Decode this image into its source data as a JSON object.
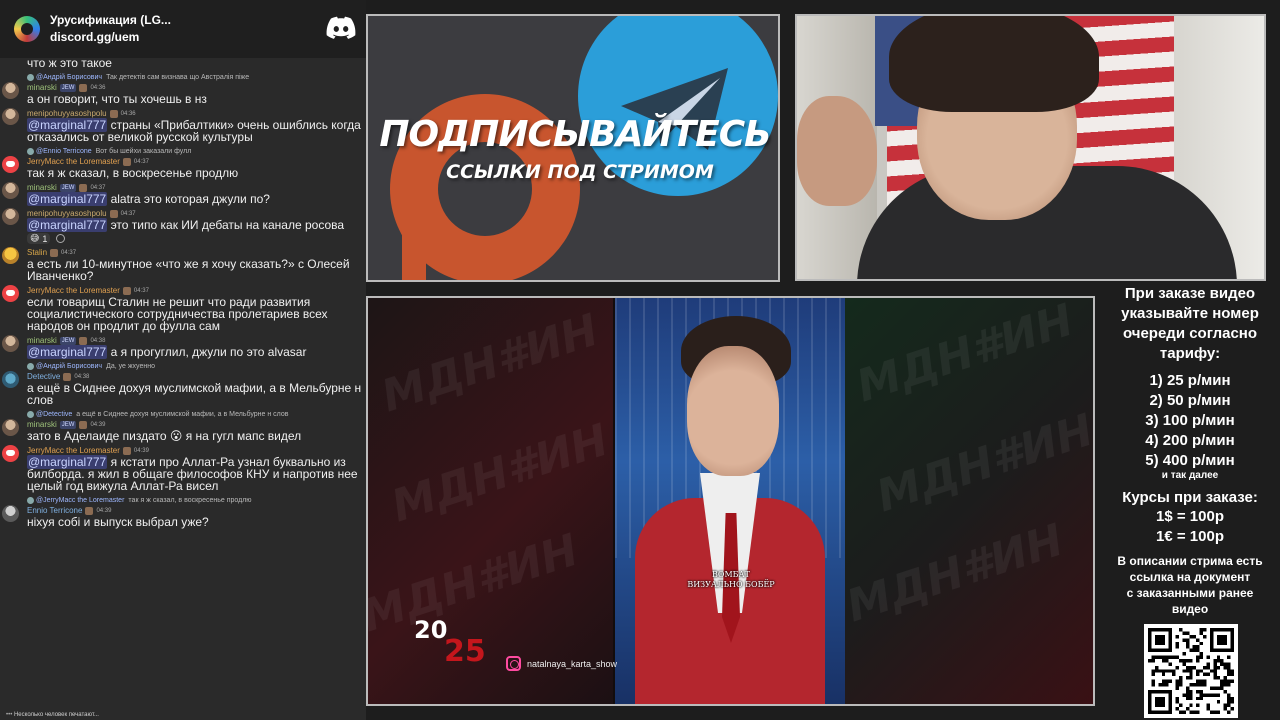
{
  "discord": {
    "server_name": "Урусификация (LG...",
    "server_link": "discord.gg/uem",
    "logo_icon": "discord-logo-icon"
  },
  "chat": {
    "messages": [
      {
        "body": "что ж это такое"
      },
      {
        "reply_author": "@Андрій Борисович",
        "reply_text": "Так детектів сам визнава що Австралія піже",
        "author": "minarski",
        "author_color": "#9ec27a",
        "badge": "JEW",
        "time": "04:36",
        "body": "а он говорит, что ты хочешь в нз",
        "avatar": "photo"
      },
      {
        "author": "menipohuyyasoshpolu",
        "author_color": "#c9a96e",
        "time": "04:36",
        "mention": "@marginal777",
        "body": " страны «Прибалтики» очень ошиблись когда отказались от великой русской культуры",
        "avatar": "photo"
      },
      {
        "reply_author": "@Ennio Terricone",
        "reply_text": "Вот бы шейхи заказали фулл",
        "author": "JerryMacc the Loremaster",
        "author_color": "#e0a050",
        "time": "04:37",
        "body": "так я ж сказал, в воскресенье продлю",
        "avatar": "discord"
      },
      {
        "author": "minarski",
        "author_color": "#9ec27a",
        "badge": "JEW",
        "time": "04:37",
        "mention": "@marginal777",
        "body": " alatra это которая джули по?",
        "avatar": "photo"
      },
      {
        "author": "menipohuyyasoshpolu",
        "author_color": "#c9a96e",
        "time": "04:37",
        "mention": "@marginal777",
        "body": " это типо как ИИ дебаты на канале росова",
        "avatar": "photo",
        "reaction_emoji": "😅",
        "reaction_count": "1"
      },
      {
        "author": "Stalin",
        "author_color": "#d7a64a",
        "time": "04:37",
        "body": "а есть ли 10-минутное  «что же я хочу сказать?» с Олесей Иванченко?",
        "avatar": "yellow"
      },
      {
        "author": "JerryMacc the Loremaster",
        "author_color": "#e0a050",
        "time": "04:37",
        "body": "если товарищ Сталин не решит что ради развития социалистического сотрудничества пролетариев всех народов  он продлит до фулла сам",
        "avatar": "discord"
      },
      {
        "author": "minarski",
        "author_color": "#9ec27a",
        "badge": "JEW",
        "time": "04:38",
        "mention": "@marginal777",
        "body": " а я прогуглил, джули по это alvasar",
        "avatar": "photo"
      },
      {
        "reply_author": "@Андрій Борисович",
        "reply_text": "Да, уе жхуенно",
        "author": "Detective",
        "author_color": "#7fb0e0",
        "time": "04:38",
        "body": "а ещё в Сиднее дохуя муслимской мафии, а в Мельбурне н слов",
        "avatar": "teal"
      },
      {
        "reply_author": "@Detective",
        "reply_text": "а ещё в Сиднее дохуя муслимской мафии, а в Мельбурне н слов",
        "author": "minarski",
        "author_color": "#9ec27a",
        "badge": "JEW",
        "time": "04:39",
        "body": "зато в Аделаиде пиздато 😮 я на гугл мапс видел",
        "avatar": "photo"
      },
      {
        "author": "JerryMacc the Loremaster",
        "author_color": "#e0a050",
        "time": "04:39",
        "mention": "@marginal777",
        "body": " я кстати про Аллат-Ра узнал буквально из билборда. я жил в общаге философов КНУ и напротив нее целый год вижула Аллат-Ра висел",
        "avatar": "discord"
      },
      {
        "reply_author": "@JerryMacc the Loremaster",
        "reply_text": "так я ж сказал, в воскресенье продлю",
        "author": "Ennio Terricone",
        "author_color": "#7fb0e0",
        "time": "04:39",
        "body": "ніхуя собі и выпуск выбрал уже?",
        "avatar": "gray"
      }
    ],
    "typing": "Несколько человек печатают..."
  },
  "promo": {
    "title": "ПОДПИСЫВАЙТЕСЬ",
    "subtitle": "ССЫЛКИ ПОД СТРИМОМ",
    "patreon_color": "#c8552e",
    "telegram_color": "#2b9ed9"
  },
  "video": {
    "caption_line1": "ВОМБАТ",
    "caption_line2": "ВИЗУАЛЬНО БОБЁР",
    "year_top": "20",
    "year_bottom": "25",
    "instagram_handle": "natalnaya_karta_show",
    "watermark": "МДН#ИН"
  },
  "order": {
    "title_lines": [
      "При заказе видео",
      "указывайте номер",
      "очереди согласно",
      "тарифу:"
    ],
    "tariffs": [
      "1) 25 р/мин",
      "2) 50 р/мин",
      "3) 100 р/мин",
      "4) 200 р/мин",
      "5) 400 р/мин"
    ],
    "tariffs_more": "и так далее",
    "rates_title": "Курсы при заказе:",
    "rates": [
      "1$ = 100р",
      "1€ = 100р"
    ],
    "description_lines": [
      "В описании стрима есть",
      "ссылка на документ",
      "с заказанными ранее",
      "видео"
    ]
  }
}
